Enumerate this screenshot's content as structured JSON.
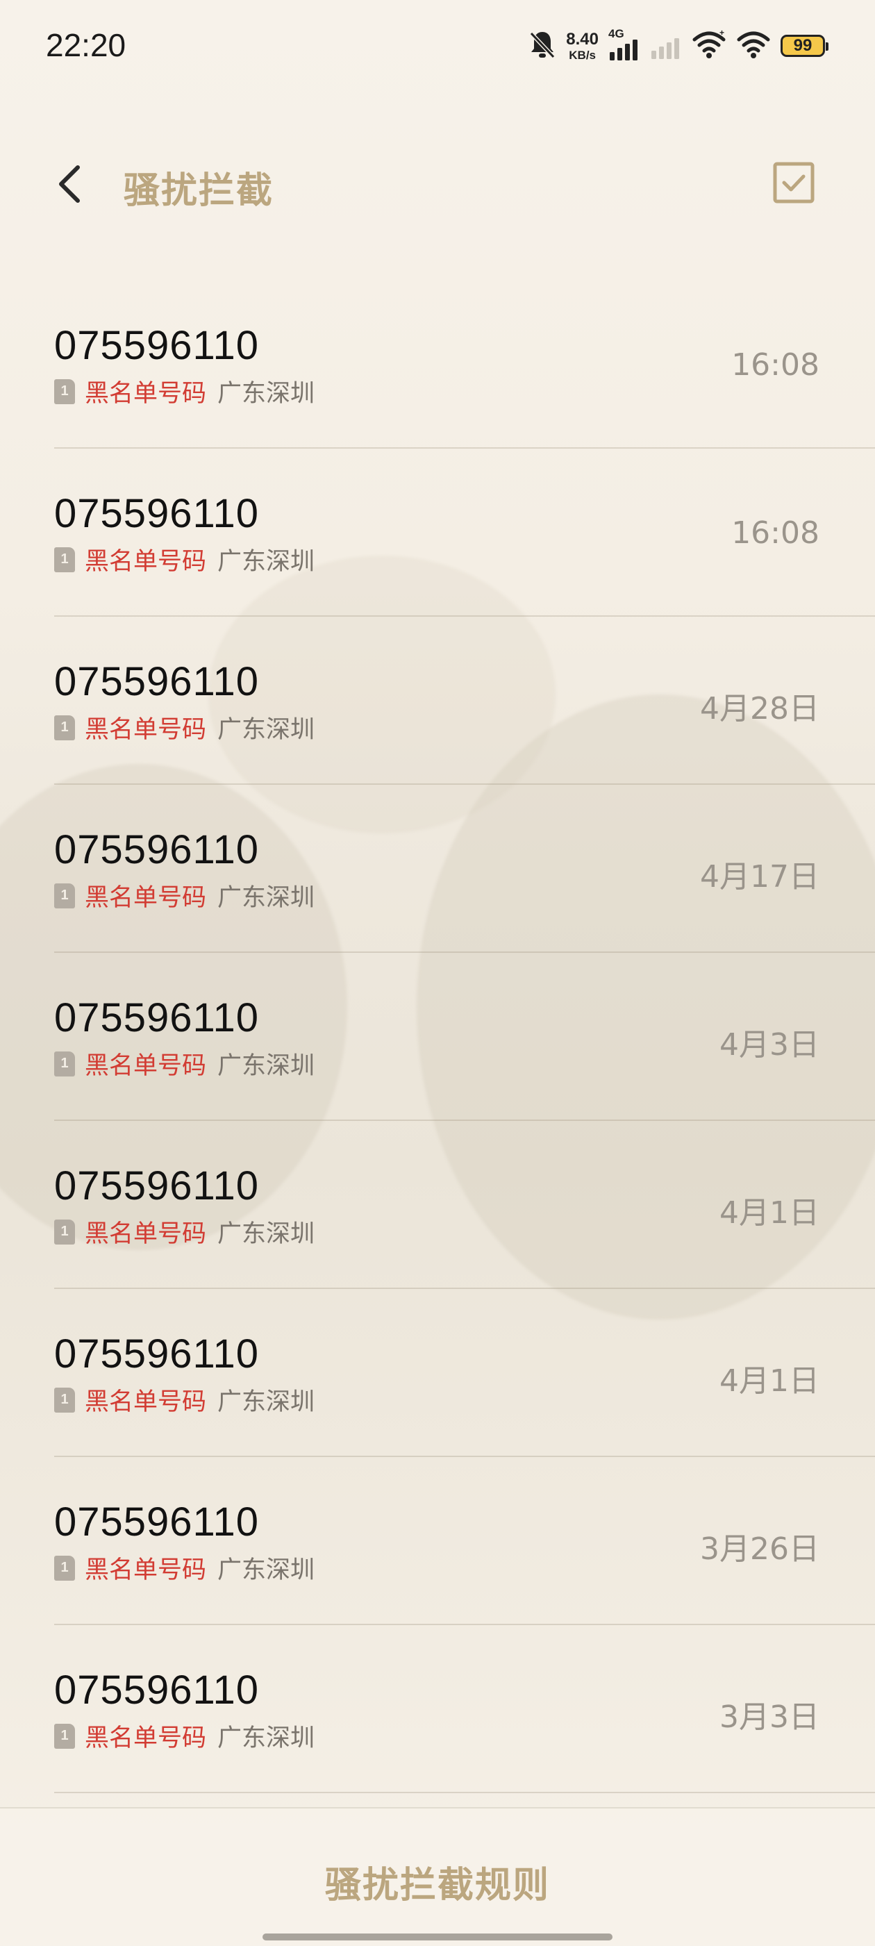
{
  "status_bar": {
    "time": "22:20",
    "net_speed_value": "8.40",
    "net_speed_unit": "KB/s",
    "network_type": "4G",
    "battery_level": "99",
    "icons": [
      "bell-muted-icon",
      "signal-icon",
      "signal-secondary-icon",
      "wifi-icon",
      "wifi-secondary-icon",
      "battery-icon"
    ]
  },
  "header": {
    "title": "骚扰拦截",
    "back_icon": "back-arrow-icon",
    "select_icon": "checkbox-select-icon"
  },
  "calls": [
    {
      "number": "075596110",
      "tag": "黑名单号码",
      "location": "广东深圳",
      "date": "16:08",
      "sim": "1"
    },
    {
      "number": "075596110",
      "tag": "黑名单号码",
      "location": "广东深圳",
      "date": "16:08",
      "sim": "1"
    },
    {
      "number": "075596110",
      "tag": "黑名单号码",
      "location": "广东深圳",
      "date": "4月28日",
      "sim": "1"
    },
    {
      "number": "075596110",
      "tag": "黑名单号码",
      "location": "广东深圳",
      "date": "4月17日",
      "sim": "1"
    },
    {
      "number": "075596110",
      "tag": "黑名单号码",
      "location": "广东深圳",
      "date": "4月3日",
      "sim": "1"
    },
    {
      "number": "075596110",
      "tag": "黑名单号码",
      "location": "广东深圳",
      "date": "4月1日",
      "sim": "1"
    },
    {
      "number": "075596110",
      "tag": "黑名单号码",
      "location": "广东深圳",
      "date": "4月1日",
      "sim": "1"
    },
    {
      "number": "075596110",
      "tag": "黑名单号码",
      "location": "广东深圳",
      "date": "3月26日",
      "sim": "1"
    },
    {
      "number": "075596110",
      "tag": "黑名单号码",
      "location": "广东深圳",
      "date": "3月3日",
      "sim": "1"
    }
  ],
  "footer": {
    "rules_label": "骚扰拦截规则"
  },
  "colors": {
    "accent": "#bba67f",
    "blacklist_tag": "#d23c33",
    "secondary_text": "#7a746c",
    "date_text": "#9a948b"
  }
}
